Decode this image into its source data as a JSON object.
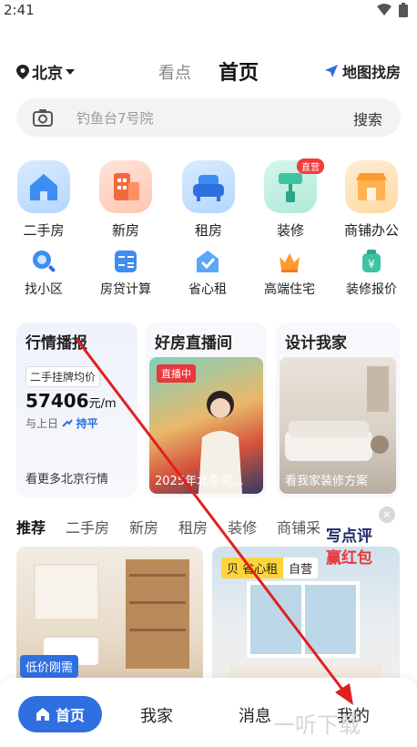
{
  "status": {
    "time": "2:41"
  },
  "header": {
    "city": "北京",
    "tab_kandian": "看点",
    "tab_home": "首页",
    "map_find": "地图找房"
  },
  "search": {
    "placeholder": "钓鱼台7号院",
    "button": "搜索"
  },
  "main_icons": [
    {
      "label": "二手房",
      "icon": "house-icon",
      "color": "#5aa0f5"
    },
    {
      "label": "新房",
      "icon": "building-icon",
      "color": "#f06a3f"
    },
    {
      "label": "租房",
      "icon": "sofa-icon",
      "color": "#3d8ef0"
    },
    {
      "label": "装修",
      "icon": "paint-roller-icon",
      "color": "#3fc2a2",
      "badge": "直营"
    },
    {
      "label": "商铺办公",
      "icon": "shop-icon",
      "color": "#ff9a2e"
    }
  ],
  "sub_icons": [
    {
      "label": "找小区",
      "icon": "magnifier-icon"
    },
    {
      "label": "房贷计算",
      "icon": "calculator-icon"
    },
    {
      "label": "省心租",
      "icon": "check-home-icon"
    },
    {
      "label": "高端住宅",
      "icon": "crown-icon"
    },
    {
      "label": "装修报价",
      "icon": "price-bag-icon"
    }
  ],
  "cards": {
    "market": {
      "title": "行情播报",
      "tag": "二手挂牌均价",
      "price": "57406",
      "unit": "元/m",
      "compare": "与上日",
      "trend": "持平",
      "more": "看更多北京行情"
    },
    "live": {
      "title": "好房直播间",
      "badge": "直播中",
      "caption": "2025年北京买..."
    },
    "design": {
      "title": "设计我家",
      "caption": "看我家装修方案"
    }
  },
  "rec_tabs": [
    "推荐",
    "二手房",
    "新房",
    "租房",
    "装修",
    "商铺采"
  ],
  "promo": {
    "line1": "写点评",
    "line2": "赢红包"
  },
  "feed": {
    "left_tag": "低价刚需",
    "right_tag_a": "贝",
    "right_tag_b": "省心租",
    "right_tag_c": "自营"
  },
  "bottom_nav": {
    "home": "首页",
    "mine_home": "我家",
    "messages": "消息",
    "me": "我的"
  },
  "watermark": "一听下载",
  "colors": {
    "brand_blue": "#2f6fe0",
    "red": "#e8383d",
    "arrow": "#e02020"
  }
}
